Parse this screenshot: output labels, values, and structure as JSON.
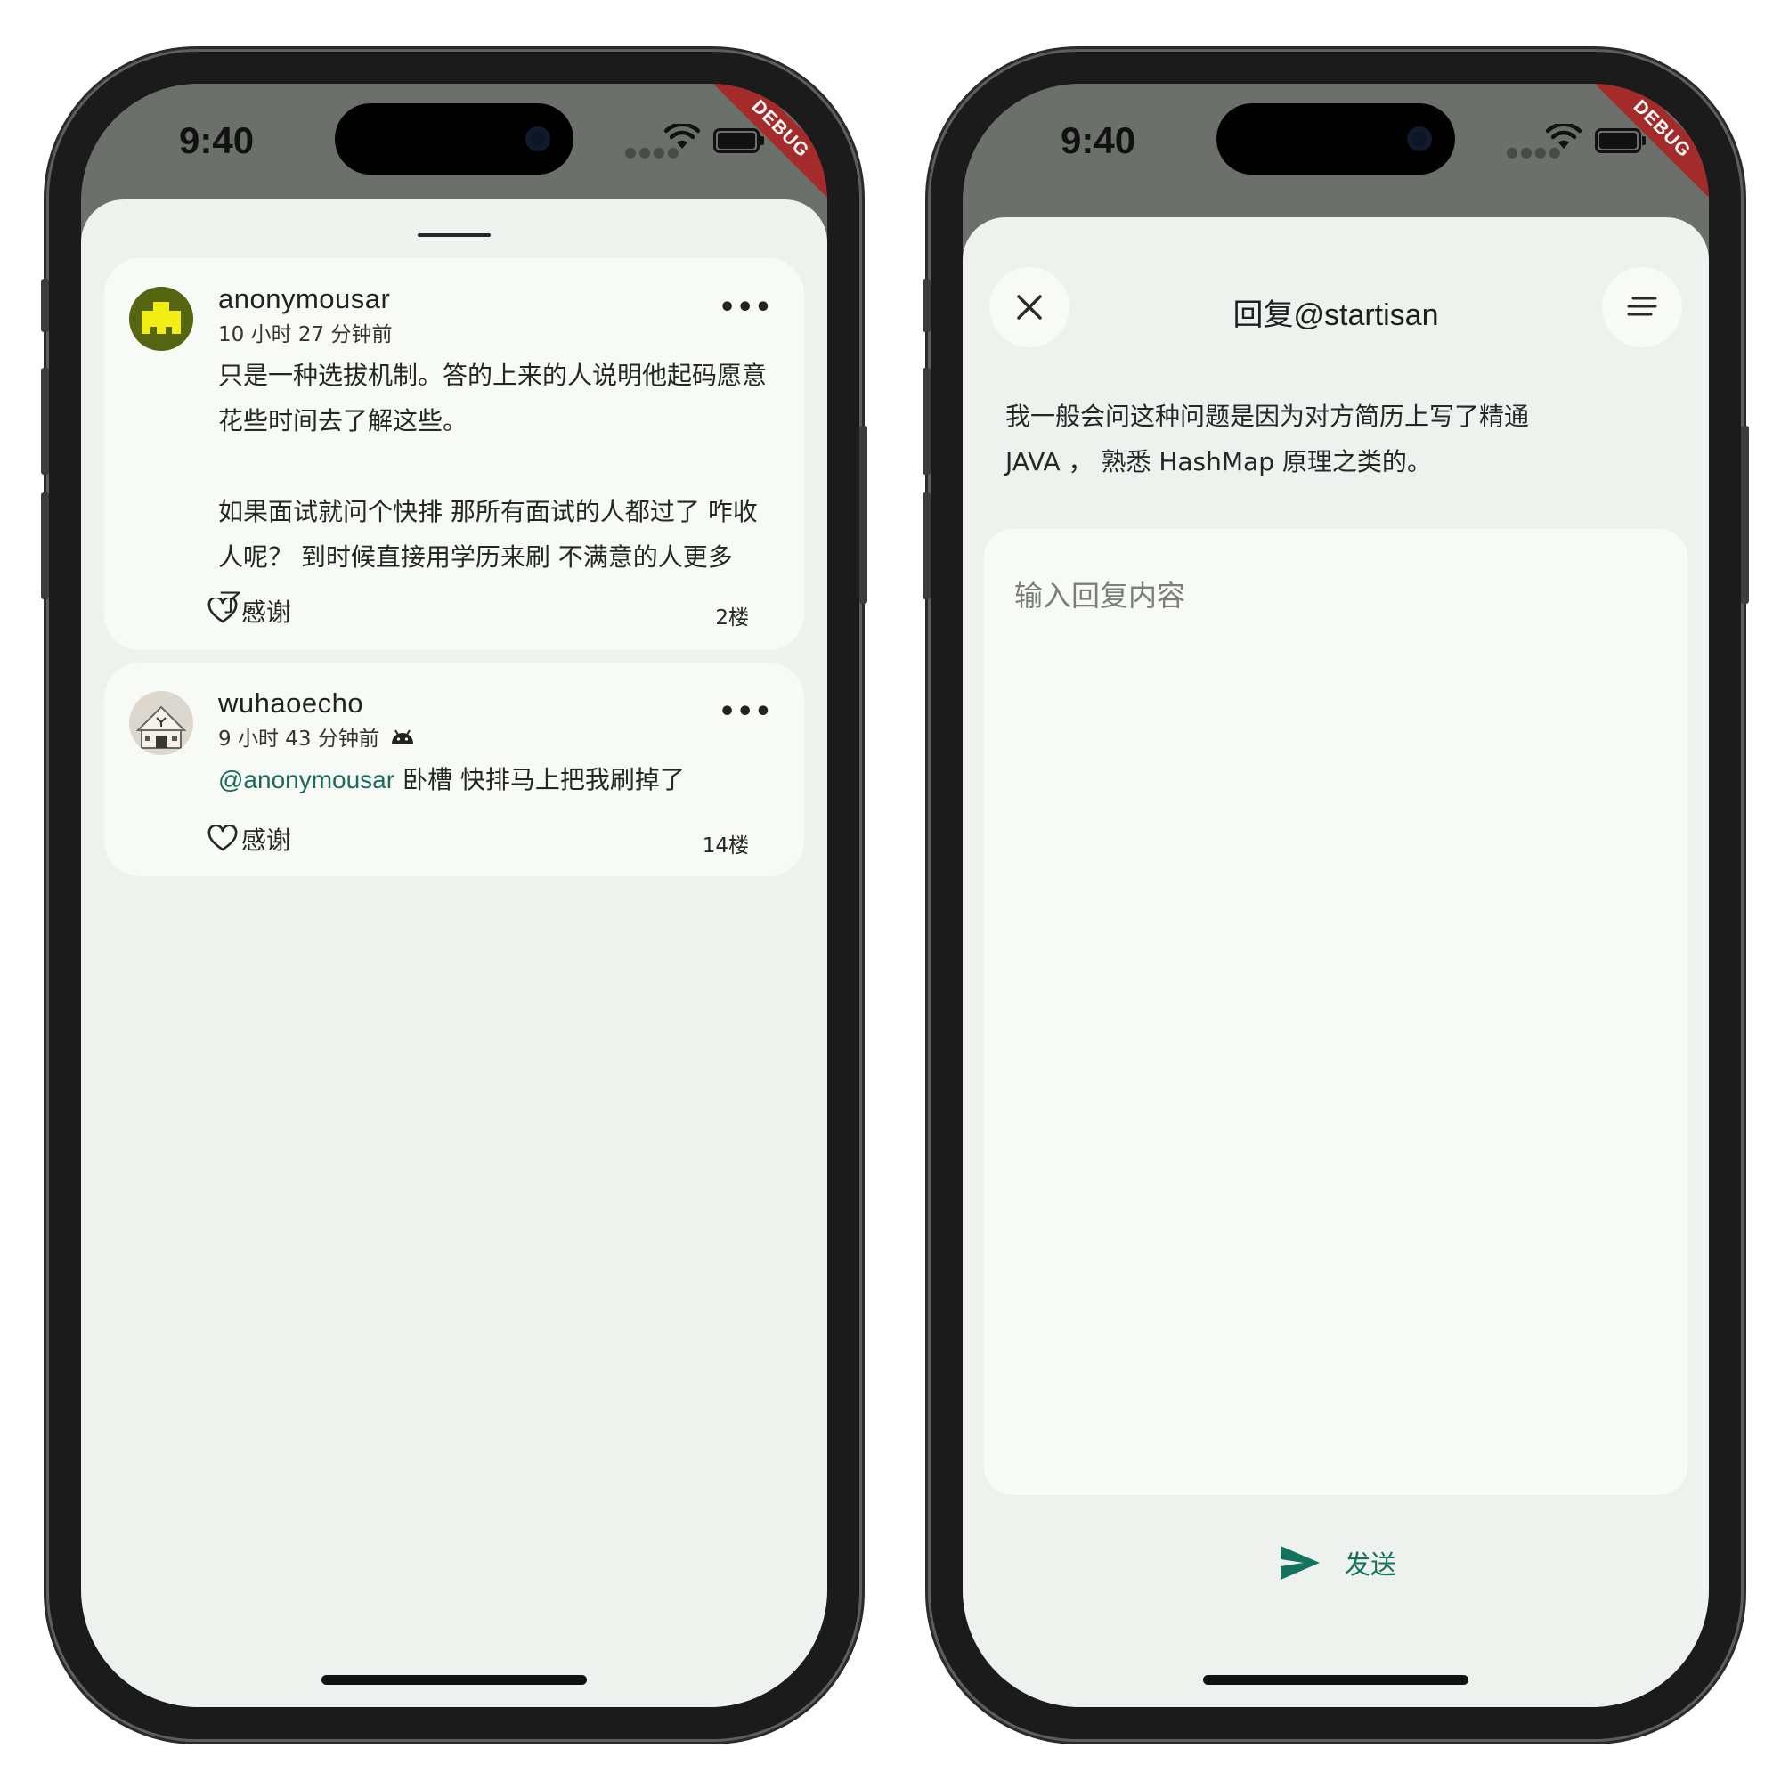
{
  "colors": {
    "accent": "#13725e",
    "sheet_bg": "#edf2ee",
    "card_bg": "#f8faf6",
    "debug_banner": "#a52a2a"
  },
  "left_screen": {
    "status_time": "9:40",
    "debug_label": "DEBUG",
    "comments": [
      {
        "username": "anonymousar",
        "time": "10 小时 27 分钟前",
        "paragraphs": [
          "只是一种选拔机制。答的上来的人说明他起码愿意花些时间去了解这些。",
          "如果面试就问个快排 那所有面试的人都过了 咋收人呢？ 到时候直接用学历来刷 不满意的人更多了。"
        ],
        "thanks_label": "感谢",
        "floor": "2楼",
        "more_icon": "more-icon"
      },
      {
        "username": "wuhaoecho",
        "time": "9 小时 43 分钟前",
        "device_icon": "android-icon",
        "mention": "@anonymousar",
        "text": " 卧槽 快排马上把我刷掉了",
        "thanks_label": "感谢",
        "floor": "14楼",
        "more_icon": "more-icon"
      }
    ]
  },
  "right_screen": {
    "status_time": "9:40",
    "debug_label": "DEBUG",
    "title": "回复@startisan",
    "quote_lines": [
      "我一般会问这种问题是因为对方简历上写了精通",
      "JAVA ， 熟悉 HashMap 原理之类的。"
    ],
    "input_placeholder": "输入回复内容",
    "send_label": "发送"
  }
}
